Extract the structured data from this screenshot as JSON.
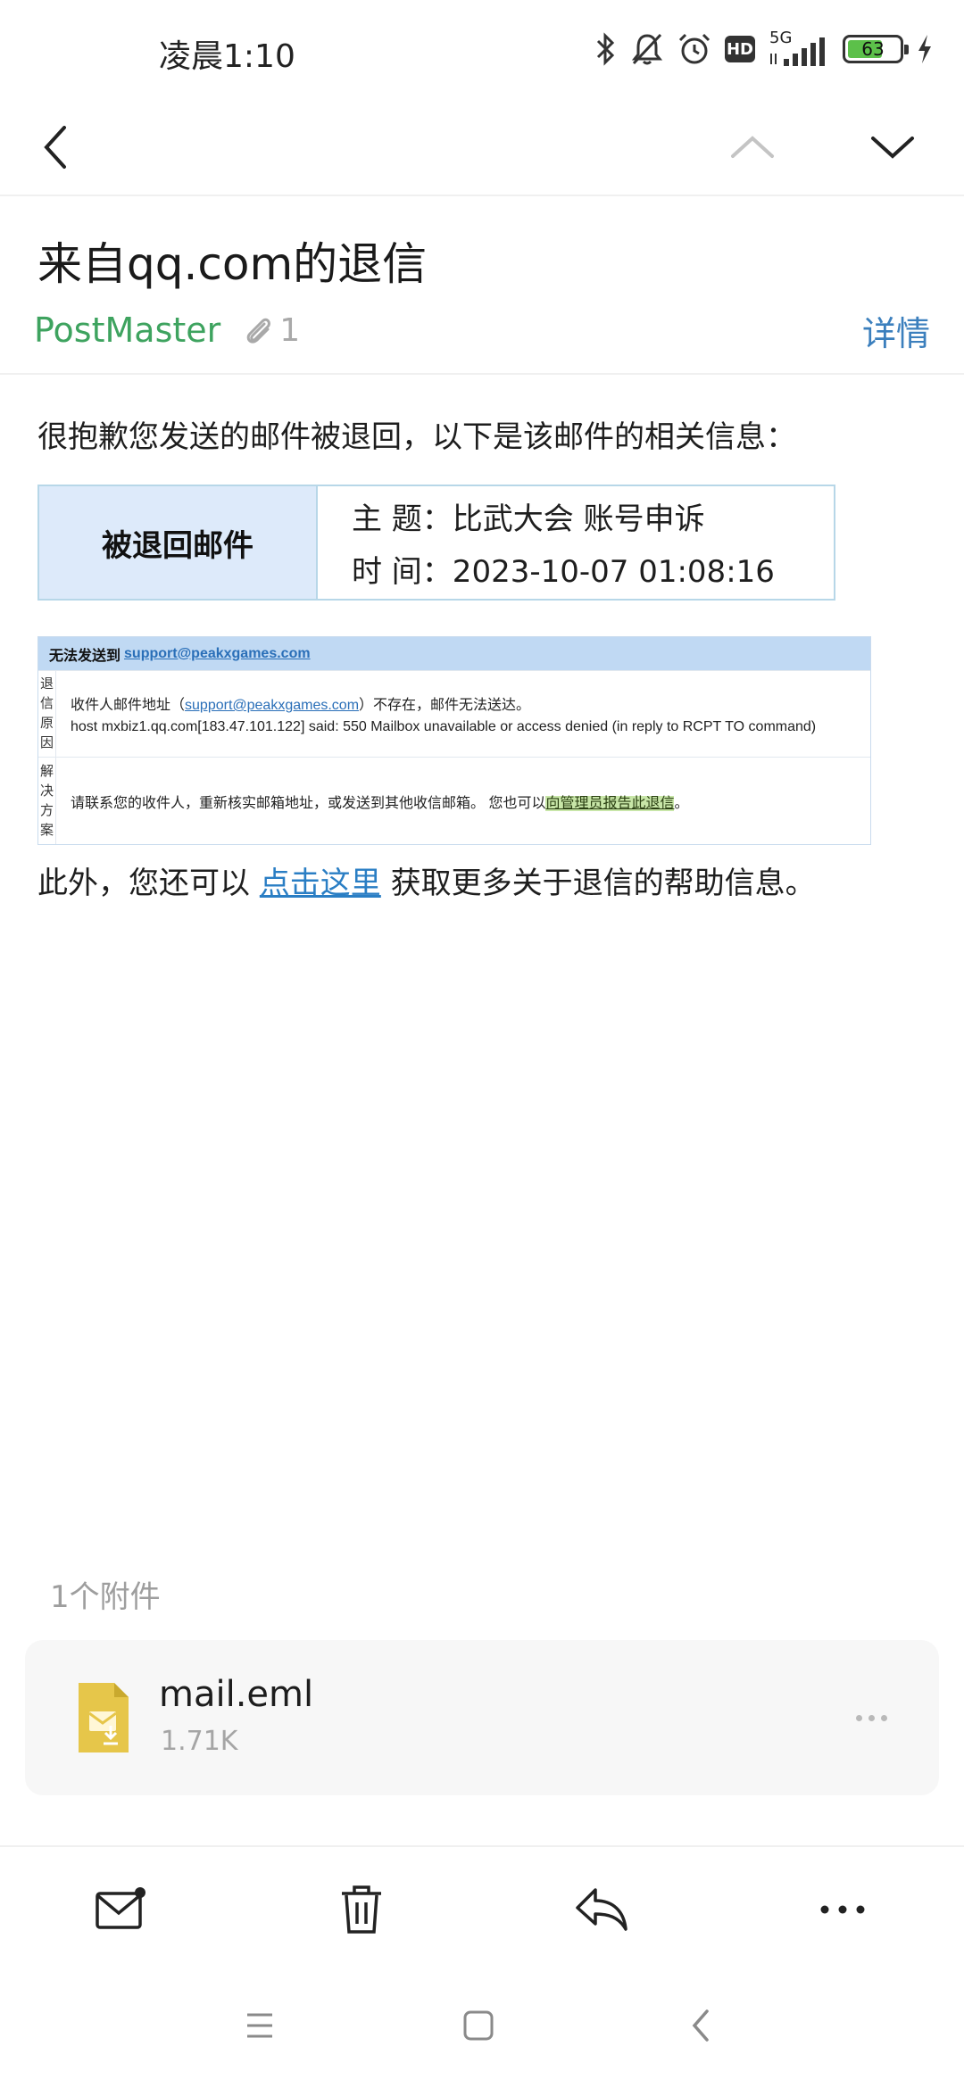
{
  "status_bar": {
    "time": "凌晨1:10",
    "network": "5G",
    "hd_badge": "HD",
    "battery_level": "63",
    "icons": [
      "bluetooth-icon",
      "bell-muted-icon",
      "alarm-icon",
      "hd-icon",
      "signal-icon",
      "battery-icon",
      "charging-icon"
    ]
  },
  "nav": {
    "icons": [
      "back-arrow-icon",
      "previous-mail-icon",
      "next-mail-icon"
    ]
  },
  "mail": {
    "subject": "来自qq.com的退信",
    "sender": "PostMaster",
    "attachment_count": "1",
    "details_label": "详情"
  },
  "body": {
    "intro": "很抱歉您发送的邮件被退回，以下是该邮件的相关信息：",
    "bounced_label": "被退回邮件",
    "subject_line": "主 题：比武大会 账号申诉",
    "time_line": "时 间：2023-10-07 01:08:16",
    "report": {
      "header_prefix": "无法发送到",
      "recipient": "support@peakxgames.com",
      "reason_label": [
        "退",
        "信",
        "原",
        "因"
      ],
      "reason_prefix": "收件人邮件地址（",
      "reason_suffix": "）不存在，邮件无法送达。",
      "reason_detail": "host mxbiz1.qq.com[183.47.101.122] said: 550 Mailbox unavailable or access denied (in reply to RCPT TO command)",
      "solution_label": [
        "解",
        "决",
        "方",
        "案"
      ],
      "solution_text": "请联系您的收件人，重新核实邮箱地址，或发送到其他收信邮箱。 您也可以",
      "solution_link": "向管理员报告此退信",
      "solution_end": "。"
    },
    "help_prefix": "此外，您还可以 ",
    "help_link": "点击这里",
    "help_suffix": " 获取更多关于退信的帮助信息。"
  },
  "attachments": {
    "title": "1个附件",
    "file_name": "mail.eml",
    "file_size": "1.71K"
  },
  "actions": [
    "mark-unread-icon",
    "delete-icon",
    "reply-icon",
    "more-icon"
  ],
  "system_nav": [
    "menu-icon",
    "home-icon",
    "back-icon"
  ],
  "colors": {
    "sender_green": "#3ea35f",
    "link_blue": "#3b7fbd",
    "table_head_bg": "#ddeafa",
    "report_head_bg": "#c0d9f3"
  }
}
